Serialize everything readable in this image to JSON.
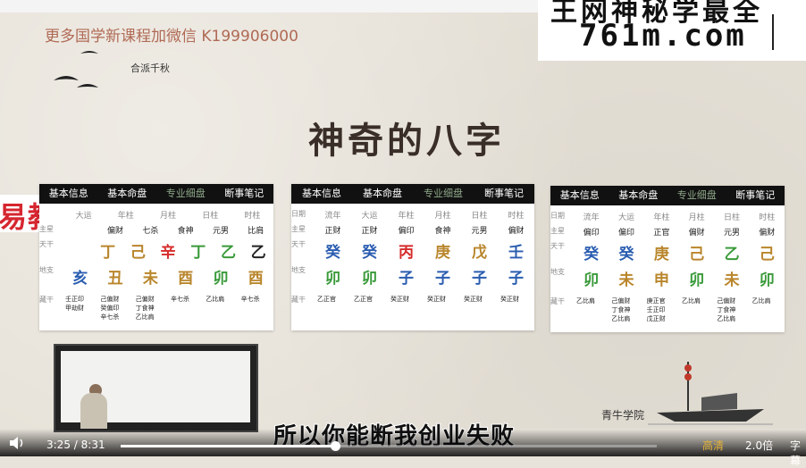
{
  "overlay": {
    "wechat_text": "更多国学新课程加微信 K199906000",
    "watermark_top": "王网神秘学最全",
    "watermark_url": "761m.com",
    "poem": "合派千秋",
    "side_label": "易教程",
    "slide_title": "神奇的八字",
    "seal_text": "青牛学院",
    "subtitle": "所以你能断我创业失败"
  },
  "charts": [
    {
      "tabs": [
        "基本信息",
        "基本命盘",
        "专业细盘",
        "断事笔记"
      ],
      "header": [
        "",
        "大运",
        "年柱",
        "月柱",
        "日柱",
        "时柱"
      ],
      "main_star_label": "主星",
      "main_star": [
        "",
        "偏财",
        "七杀",
        "食神",
        "元男",
        "比肩"
      ],
      "stem_label": "天干",
      "stems": [
        "",
        "丁",
        "己",
        "辛",
        "丁",
        "乙",
        "乙"
      ],
      "stem_colors": [
        "#d62b2b",
        "#b9862c",
        "#b9862c",
        "#d62b2b",
        "#3a9a3a",
        "#3a9a3a"
      ],
      "branch_label": "地支",
      "branches": [
        "亥",
        "丑",
        "未",
        "酉",
        "卯",
        "酉"
      ],
      "branch_colors": [
        "#2a5db0",
        "#b9862c",
        "#b9862c",
        "#b9862c",
        "#3a9a3a",
        "#b9862c"
      ],
      "hidden_label": "藏干",
      "hidden": [
        [
          "壬正印",
          "甲劫财"
        ],
        [
          "己偏财",
          "癸偏印",
          "辛七杀"
        ],
        [
          "己偏财",
          "丁食神",
          "乙比肩"
        ],
        [
          "辛七杀"
        ],
        [
          "乙比肩"
        ],
        [
          "辛七杀"
        ]
      ]
    },
    {
      "tabs": [
        "基本信息",
        "基本命盘",
        "专业细盘",
        "断事笔记"
      ],
      "header": [
        "日期",
        "流年",
        "大运",
        "年柱",
        "月柱",
        "日柱",
        "时柱"
      ],
      "main_star_label": "主星",
      "main_star": [
        "正财",
        "正财",
        "偏印",
        "食神",
        "元男",
        "偏财"
      ],
      "stem_label": "天干",
      "stems": [
        "癸",
        "癸",
        "丙",
        "庚",
        "戊",
        "壬"
      ],
      "stem_colors": [
        "#2a5db0",
        "#2a5db0",
        "#d62b2b",
        "#b9862c",
        "#b9862c",
        "#2a5db0"
      ],
      "branch_label": "地支",
      "branches": [
        "卯",
        "卯",
        "子",
        "子",
        "子",
        "子"
      ],
      "branch_colors": [
        "#3a9a3a",
        "#3a9a3a",
        "#2a5db0",
        "#2a5db0",
        "#2a5db0",
        "#2a5db0"
      ],
      "hidden_label": "藏干",
      "hidden": [
        [
          "乙正官"
        ],
        [
          "乙正官"
        ],
        [
          "癸正财"
        ],
        [
          "癸正财"
        ],
        [
          "癸正财"
        ],
        [
          "癸正财"
        ]
      ]
    },
    {
      "tabs": [
        "基本信息",
        "基本命盘",
        "专业细盘",
        "断事笔记"
      ],
      "header": [
        "日期",
        "流年",
        "大运",
        "年柱",
        "月柱",
        "日柱",
        "时柱"
      ],
      "main_star_label": "主星",
      "main_star": [
        "偏印",
        "偏印",
        "正官",
        "偏财",
        "元男",
        "偏财"
      ],
      "stem_label": "天干",
      "stems": [
        "癸",
        "癸",
        "庚",
        "己",
        "乙",
        "己"
      ],
      "stem_colors": [
        "#2a5db0",
        "#2a5db0",
        "#b9862c",
        "#b9862c",
        "#3a9a3a",
        "#b9862c"
      ],
      "branch_label": "地支",
      "branches": [
        "卯",
        "未",
        "申",
        "卯",
        "未",
        "卯"
      ],
      "branch_colors": [
        "#3a9a3a",
        "#b9862c",
        "#b9862c",
        "#3a9a3a",
        "#b9862c",
        "#3a9a3a"
      ],
      "hidden_label": "藏干",
      "hidden": [
        [
          "乙比肩"
        ],
        [
          "己偏财",
          "丁食神",
          "乙比肩"
        ],
        [
          "庚正官",
          "壬正印",
          "戊正财"
        ],
        [
          "乙比肩"
        ],
        [
          "己偏财",
          "丁食神",
          "乙比肩"
        ],
        [
          "乙比肩"
        ]
      ]
    }
  ],
  "player": {
    "current_time": "3:25",
    "separator": "/",
    "duration": "8:31",
    "progress_fraction": 0.4,
    "quality": "高清",
    "speed": "2.0倍",
    "subtitle_btn": "字幕"
  }
}
